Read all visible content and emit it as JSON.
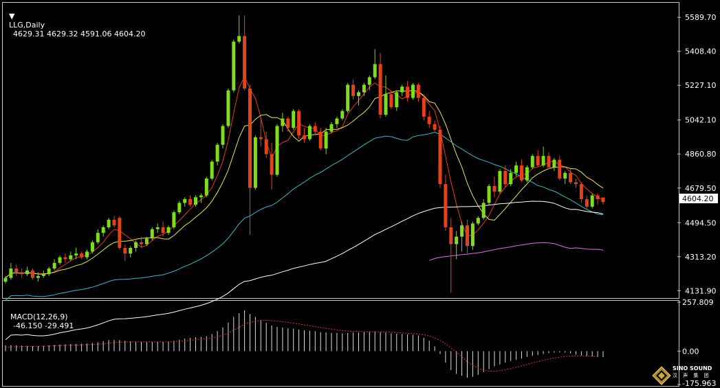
{
  "header": {
    "symbol": "LLG,Daily",
    "ohlc": "4629.31 4629.32 4591.06 4604.20",
    "macd_label": "MACD(12,26,9)",
    "macd_values": "-46.150 -29.491"
  },
  "price_axis": {
    "ticks": [
      "5589.70",
      "5408.40",
      "5227.10",
      "5042.10",
      "4860.80",
      "4679.50",
      "4494.50",
      "4313.20",
      "4131.90"
    ],
    "current": "4604.20"
  },
  "macd_axis": {
    "ticks": [
      "257.809",
      "0.00",
      "-175.963"
    ]
  },
  "watermark": {
    "name": "SINO SOUND",
    "sub": "汉 声 集 团"
  },
  "colors": {
    "bull": "#7fdd1e",
    "bear": "#e8401a",
    "ma_fast": "#e83a1a",
    "ma_mid": "#e8e85a",
    "ma_slow": "#3fb8c8",
    "ma_long": "#ffffff",
    "ma_vlong": "#e070e0",
    "macd_hist": "#e0e0e0",
    "macd_signal": "#e83a1a",
    "grid": "#c8c8c8"
  },
  "chart_data": {
    "type": "candlestick",
    "price_range": [
      4100,
      5660
    ],
    "candles": [
      [
        4180,
        4210,
        4170,
        4200
      ],
      [
        4200,
        4280,
        4190,
        4250
      ],
      [
        4250,
        4270,
        4210,
        4230
      ],
      [
        4230,
        4250,
        4200,
        4220
      ],
      [
        4220,
        4260,
        4210,
        4240
      ],
      [
        4240,
        4250,
        4190,
        4200
      ],
      [
        4200,
        4230,
        4180,
        4210
      ],
      [
        4210,
        4240,
        4200,
        4220
      ],
      [
        4220,
        4260,
        4210,
        4250
      ],
      [
        4250,
        4300,
        4240,
        4280
      ],
      [
        4280,
        4320,
        4270,
        4310
      ],
      [
        4310,
        4330,
        4280,
        4300
      ],
      [
        4300,
        4340,
        4290,
        4320
      ],
      [
        4320,
        4360,
        4300,
        4330
      ],
      [
        4330,
        4340,
        4300,
        4310
      ],
      [
        4310,
        4350,
        4300,
        4340
      ],
      [
        4340,
        4400,
        4330,
        4390
      ],
      [
        4390,
        4460,
        4380,
        4440
      ],
      [
        4440,
        4480,
        4420,
        4470
      ],
      [
        4470,
        4520,
        4460,
        4510
      ],
      [
        4510,
        4530,
        4470,
        4480
      ],
      [
        4520,
        4530,
        4350,
        4360
      ],
      [
        4360,
        4380,
        4290,
        4330
      ],
      [
        4330,
        4370,
        4310,
        4360
      ],
      [
        4360,
        4400,
        4340,
        4390
      ],
      [
        4390,
        4420,
        4360,
        4380
      ],
      [
        4380,
        4420,
        4370,
        4410
      ],
      [
        4410,
        4470,
        4400,
        4460
      ],
      [
        4460,
        4490,
        4440,
        4470
      ],
      [
        4470,
        4500,
        4420,
        4440
      ],
      [
        4440,
        4480,
        4430,
        4470
      ],
      [
        4470,
        4560,
        4460,
        4550
      ],
      [
        4550,
        4610,
        4540,
        4600
      ],
      [
        4600,
        4630,
        4580,
        4620
      ],
      [
        4620,
        4640,
        4580,
        4590
      ],
      [
        4590,
        4640,
        4580,
        4630
      ],
      [
        4630,
        4650,
        4600,
        4640
      ],
      [
        4640,
        4740,
        4630,
        4730
      ],
      [
        4730,
        4830,
        4720,
        4820
      ],
      [
        4820,
        4920,
        4800,
        4910
      ],
      [
        4910,
        5020,
        4890,
        5010
      ],
      [
        5010,
        5210,
        5000,
        5200
      ],
      [
        5200,
        5470,
        5190,
        5460
      ],
      [
        5460,
        5600,
        5450,
        5490
      ],
      [
        5490,
        5600,
        5200,
        5210
      ],
      [
        5210,
        5230,
        4430,
        4680
      ],
      [
        4680,
        4960,
        4670,
        4950
      ],
      [
        4950,
        5060,
        4900,
        4940
      ],
      [
        4940,
        4980,
        4840,
        4860
      ],
      [
        4860,
        4920,
        4670,
        4750
      ],
      [
        4750,
        5020,
        4740,
        5010
      ],
      [
        5010,
        5080,
        4980,
        5050
      ],
      [
        5050,
        5060,
        4980,
        5000
      ],
      [
        5000,
        5100,
        4990,
        5090
      ],
      [
        5090,
        5100,
        4940,
        4960
      ],
      [
        4960,
        5000,
        4920,
        4940
      ],
      [
        4940,
        5020,
        4930,
        5010
      ],
      [
        5010,
        5030,
        4960,
        4980
      ],
      [
        4980,
        5000,
        4880,
        4890
      ],
      [
        4890,
        5000,
        4860,
        4980
      ],
      [
        4980,
        5030,
        4970,
        5020
      ],
      [
        5020,
        5060,
        5000,
        5050
      ],
      [
        5050,
        5100,
        5040,
        5090
      ],
      [
        5090,
        5240,
        5080,
        5230
      ],
      [
        5230,
        5260,
        5150,
        5170
      ],
      [
        5170,
        5200,
        5120,
        5190
      ],
      [
        5190,
        5240,
        5170,
        5230
      ],
      [
        5230,
        5280,
        5200,
        5270
      ],
      [
        5270,
        5420,
        5260,
        5340
      ],
      [
        5340,
        5400,
        5050,
        5070
      ],
      [
        5070,
        5280,
        5060,
        5180
      ],
      [
        5180,
        5200,
        5100,
        5110
      ],
      [
        5110,
        5200,
        5090,
        5190
      ],
      [
        5190,
        5230,
        5170,
        5220
      ],
      [
        5220,
        5250,
        5140,
        5160
      ],
      [
        5160,
        5240,
        5150,
        5230
      ],
      [
        5230,
        5240,
        5140,
        5160
      ],
      [
        5160,
        5170,
        5040,
        5060
      ],
      [
        5060,
        5090,
        5000,
        5020
      ],
      [
        5020,
        5040,
        4980,
        4990
      ],
      [
        4990,
        5010,
        4680,
        4700
      ],
      [
        4700,
        4750,
        4450,
        4470
      ],
      [
        4470,
        4520,
        4120,
        4380
      ],
      [
        4380,
        4450,
        4300,
        4420
      ],
      [
        4420,
        4500,
        4340,
        4480
      ],
      [
        4480,
        4510,
        4330,
        4370
      ],
      [
        4370,
        4500,
        4350,
        4490
      ],
      [
        4490,
        4530,
        4480,
        4520
      ],
      [
        4520,
        4620,
        4510,
        4600
      ],
      [
        4600,
        4700,
        4590,
        4690
      ],
      [
        4690,
        4740,
        4630,
        4660
      ],
      [
        4660,
        4780,
        4650,
        4770
      ],
      [
        4770,
        4800,
        4680,
        4700
      ],
      [
        4700,
        4780,
        4690,
        4760
      ],
      [
        4760,
        4820,
        4740,
        4800
      ],
      [
        4800,
        4830,
        4710,
        4720
      ],
      [
        4720,
        4800,
        4710,
        4790
      ],
      [
        4790,
        4860,
        4780,
        4850
      ],
      [
        4850,
        4880,
        4790,
        4800
      ],
      [
        4800,
        4900,
        4790,
        4850
      ],
      [
        4850,
        4870,
        4780,
        4790
      ],
      [
        4790,
        4840,
        4770,
        4830
      ],
      [
        4830,
        4850,
        4720,
        4730
      ],
      [
        4730,
        4770,
        4700,
        4760
      ],
      [
        4760,
        4780,
        4700,
        4710
      ],
      [
        4710,
        4730,
        4680,
        4700
      ],
      [
        4700,
        4710,
        4600,
        4620
      ],
      [
        4620,
        4640,
        4570,
        4580
      ],
      [
        4580,
        4650,
        4570,
        4640
      ],
      [
        4640,
        4650,
        4590,
        4620
      ],
      [
        4629.31,
        4629.32,
        4591.06,
        4604.2
      ]
    ],
    "macd_range": [
      -175.963,
      257.809
    ],
    "macd_hist": [
      30,
      32,
      31,
      29,
      28,
      27,
      27,
      28,
      30,
      33,
      35,
      36,
      37,
      38,
      38,
      40,
      43,
      47,
      52,
      58,
      60,
      58,
      55,
      52,
      50,
      49,
      48,
      49,
      50,
      50,
      51,
      55,
      60,
      66,
      70,
      72,
      74,
      78,
      90,
      105,
      125,
      150,
      180,
      200,
      215,
      195,
      180,
      165,
      150,
      135,
      128,
      124,
      120,
      118,
      114,
      110,
      108,
      105,
      100,
      98,
      96,
      95,
      94,
      96,
      98,
      98,
      100,
      102,
      104,
      100,
      98,
      94,
      92,
      90,
      88,
      86,
      82,
      70,
      55,
      25,
      -15,
      -60,
      -100,
      -120,
      -130,
      -140,
      -135,
      -125,
      -110,
      -95,
      -80,
      -70,
      -60,
      -52,
      -45,
      -38,
      -30,
      -25,
      -20,
      -15,
      -10,
      -8,
      -6,
      -8,
      -12,
      -18,
      -22,
      -26,
      -28,
      -30,
      -32
    ],
    "macd_signal": [
      20,
      22,
      23,
      24,
      25,
      25,
      26,
      26,
      27,
      28,
      29,
      30,
      31,
      32,
      33,
      34,
      35,
      37,
      39,
      42,
      45,
      47,
      48,
      49,
      49,
      49,
      49,
      49,
      49,
      49,
      49,
      50,
      52,
      54,
      57,
      60,
      63,
      66,
      70,
      76,
      84,
      95,
      110,
      126,
      142,
      152,
      158,
      161,
      162,
      161,
      158,
      155,
      151,
      147,
      143,
      138,
      134,
      129,
      124,
      120,
      116,
      112,
      108,
      105,
      104,
      103,
      102,
      102,
      102,
      102,
      101,
      100,
      98,
      96,
      94,
      92,
      90,
      86,
      80,
      70,
      56,
      38,
      16,
      -6,
      -30,
      -55,
      -75,
      -90,
      -100,
      -105,
      -105,
      -103,
      -98,
      -92,
      -85,
      -78,
      -70,
      -62,
      -55,
      -48,
      -42,
      -36,
      -32,
      -28,
      -26,
      -25,
      -25,
      -26,
      -27,
      -28
    ]
  }
}
